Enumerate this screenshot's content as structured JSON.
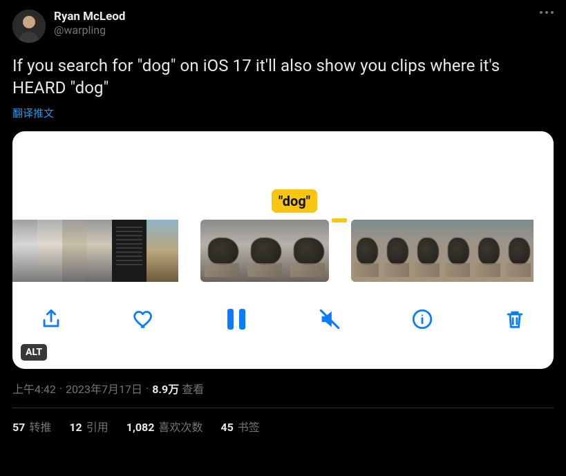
{
  "user": {
    "display_name": "Ryan McLeod",
    "handle": "@warpling"
  },
  "tweet": {
    "text": "If you search for \"dog\" on iOS 17 it'll also show you clips where it's HEARD \"dog\"",
    "translate_label": "翻译推文"
  },
  "media": {
    "search_token_label": "\"dog\"",
    "alt_badge": "ALT"
  },
  "meta": {
    "time": "上午4:42",
    "date": "2023年7月17日",
    "views_value": "8.9万",
    "views_label": "查看"
  },
  "stats": {
    "retweets": {
      "value": "57",
      "label": "转推"
    },
    "quotes": {
      "value": "12",
      "label": "引用"
    },
    "likes": {
      "value": "1,082",
      "label": "喜欢次数"
    },
    "bookmarks": {
      "value": "45",
      "label": "书签"
    }
  }
}
